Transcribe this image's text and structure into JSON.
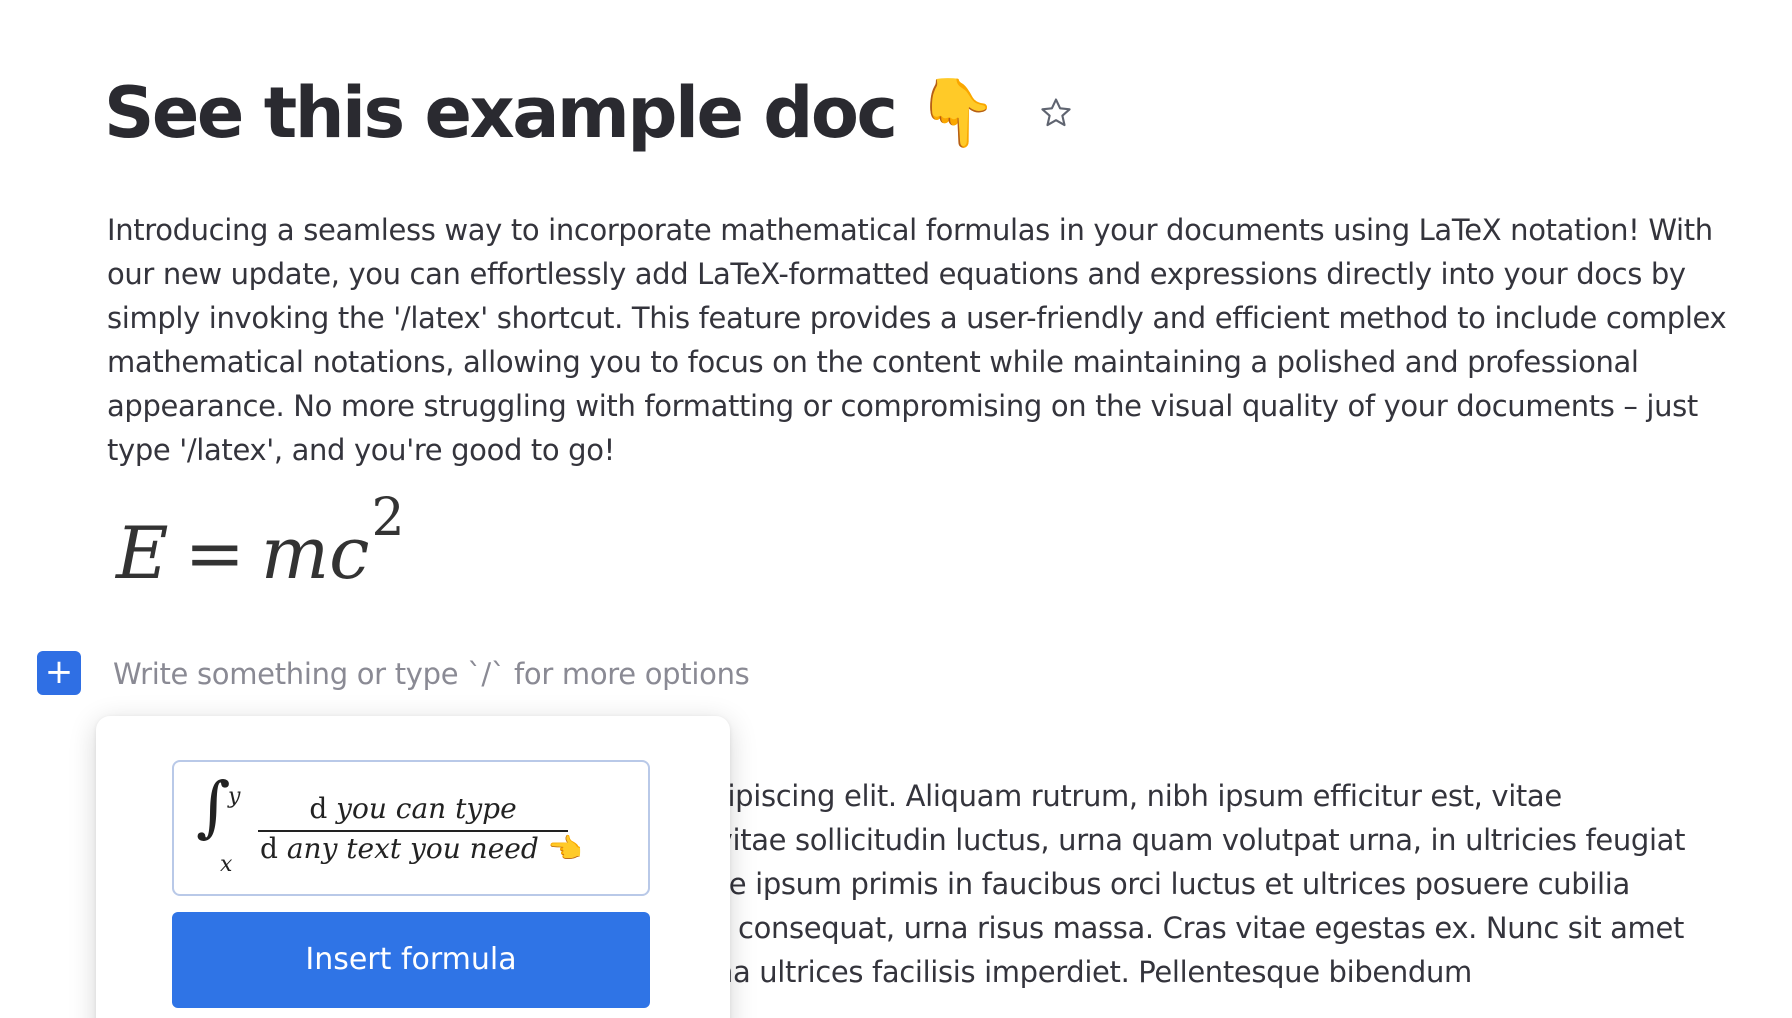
{
  "document": {
    "title": "See this example doc",
    "title_emoji": "👇",
    "star_icon": "star-outline-icon",
    "intro_paragraph": "Introducing a seamless way to incorporate mathematical formulas in your documents using LaTeX notation! With our new update, you can effortlessly add LaTeX-formatted equations and expressions directly into your docs by simply invoking the '/latex' shortcut. This feature provides a user-friendly and efficient method to include complex mathematical notations, allowing you to focus on the content while maintaining a polished and professional appearance. No more struggling with formatting or compromising on the visual quality of your documents – just type '/latex', and you're good to go!",
    "formula": {
      "lhs": "E",
      "equals": "=",
      "rhs": "mc",
      "exponent": "2"
    },
    "placeholder": "Write something or type `/` for more options",
    "add_block_label": "+",
    "body_paragraph": "Lorem ipsum dolor sit amet, consectetur adipiscing elit. Aliquam rutrum, nibh ipsum efficitur est, vitae vestibulum eros odio ut felis. Pellentesque vitae sollicitudin luctus, urna quam volutpat urna, in ultricies feugiat pellentesque a euismod leo. Vestibulum ante ipsum primis in faucibus orci luctus et ultrices posuere cubilia curae; Nam fermentum, velit quis dignissim consequat, urna risus massa. Cras vitae egestas ex. Nunc sit amet eros eros. Nam a augue eu diam rutrum urna ultrices facilisis imperdiet. Pellentesque bibendum"
  },
  "latex_popup": {
    "integral_symbol": "∫",
    "upper_limit": "y",
    "lower_limit": "x",
    "numerator_d": "d",
    "numerator_text": "you can type",
    "denominator_d": "d",
    "denominator_text": "any text you need",
    "denominator_emoji": "👈",
    "insert_button_label": "Insert formula"
  },
  "colors": {
    "accent": "#2f74e6",
    "text": "#34343c",
    "placeholder": "#8a8a94"
  }
}
